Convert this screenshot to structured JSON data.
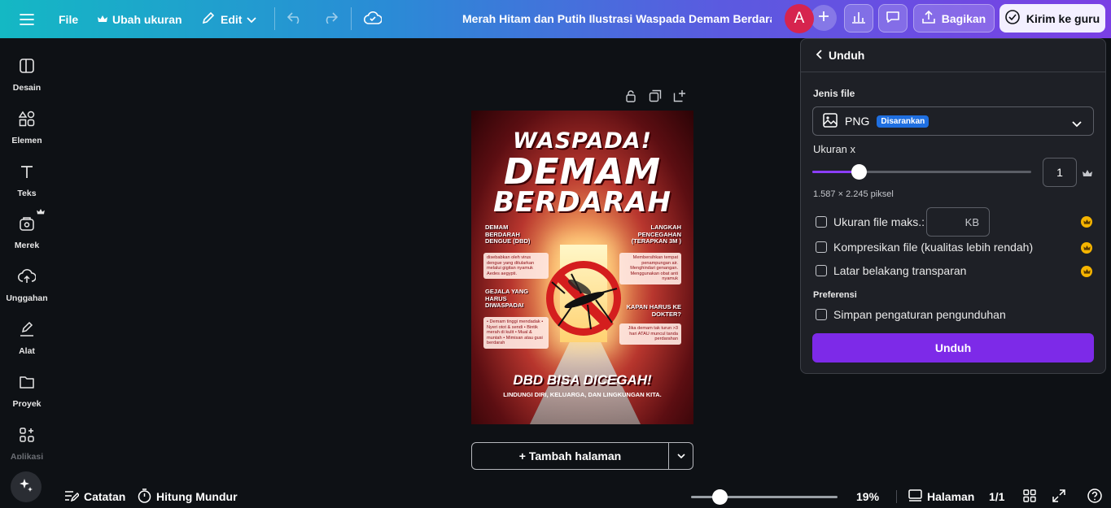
{
  "topbar": {
    "file": "File",
    "resize": "Ubah ukuran",
    "edit": "Edit",
    "doc_title": "Merah Hitam dan Putih Ilustrasi Waspada Demam Berdarah...",
    "avatar_letter": "A",
    "share": "Bagikan",
    "send": "Kirim ke guru"
  },
  "sidebar": {
    "items": [
      {
        "label": "Desain"
      },
      {
        "label": "Elemen"
      },
      {
        "label": "Teks"
      },
      {
        "label": "Merek"
      },
      {
        "label": "Unggahan"
      },
      {
        "label": "Alat"
      },
      {
        "label": "Proyek"
      },
      {
        "label": "Aplikasi"
      }
    ]
  },
  "poster": {
    "line1": "WASPADA!",
    "line2": "DEMAM",
    "line3": "BERDARAH",
    "h_left1": "DEMAM BERDARAH DENGUE (DBD)",
    "b_left1": "disebabkan oleh virus dengue yang ditularkan melalui gigitan nyamuk Aedes aegypti.",
    "h_right1": "LANGKAH PENCEGAHAN (TERAPKAN 3M )",
    "b_right1": "Membersihkan tempat penampungan air. Menghindari genangan. Menggunakan obat anti nyamuk",
    "h_left2": "GEJALA YANG HARUS DIWASPADAI",
    "b_left2": "• Demam tinggi mendadak • Nyeri otot & sendi • Bintik merah di kulit • Mual & muntah • Mimisan atau gusi berdarah",
    "h_right2": "KAPAN HARUS KE DOKTER?",
    "b_right2": "Jika demam tak turun >3 hari ATAU muncul tanda perdarahan",
    "footer1": "DBD BISA DICEGAH!",
    "footer2": "LINDUNGI DIRI, KELUARGA, DAN LINGKUNGAN KITA."
  },
  "canvas": {
    "add_page": "+ Tambah halaman"
  },
  "bottombar": {
    "notes": "Catatan",
    "timer": "Hitung Mundur",
    "zoom": "19%",
    "pages": "Halaman",
    "page_count": "1/1"
  },
  "download_panel": {
    "title": "Unduh",
    "file_type_label": "Jenis file",
    "file_type": "PNG",
    "recommended": "Disarankan",
    "size_label": "Ukuran x",
    "size_value": "1",
    "pixels": "1.587 × 2.245 piksel",
    "max_size_label": "Ukuran file maks.:",
    "kb": "KB",
    "compress_label": "Kompresikan file (kualitas lebih rendah)",
    "transparent_label": "Latar belakang transparan",
    "prefs_label": "Preferensi",
    "save_prefs_label": "Simpan pengaturan pengunduhan",
    "download_button": "Unduh"
  },
  "colors": {
    "accent": "#7d2ae8",
    "badge": "#1f6fe0",
    "crown": "#f5b400",
    "avatar": "#d6244e"
  }
}
